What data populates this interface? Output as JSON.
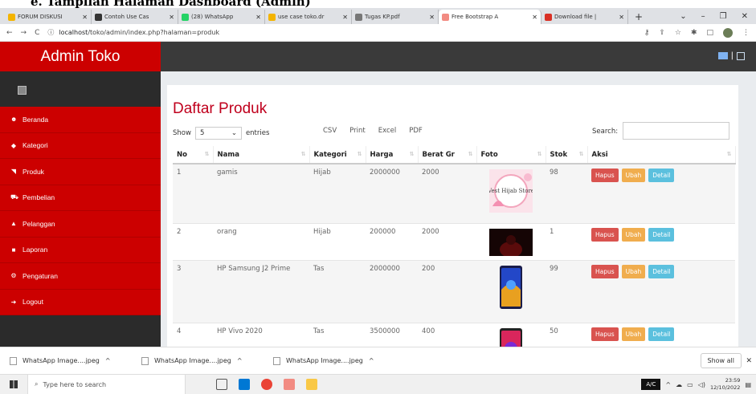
{
  "doc_caption": "e.  Tampilan Halaman Dashboard (Admin)",
  "browser": {
    "tabs": [
      {
        "label": "FORUM DISKUSI",
        "color": "#f4b400"
      },
      {
        "label": "Contoh Use Cas",
        "color": "#333333"
      },
      {
        "label": "(28) WhatsApp",
        "color": "#25d366"
      },
      {
        "label": "use case toko.dr",
        "color": "#f4b400"
      },
      {
        "label": "Tugas KP.pdf",
        "color": "#777777"
      },
      {
        "label": "Free Bootstrap A",
        "color": "#f28b82",
        "active": true
      },
      {
        "label": "Download file | ",
        "color": "#d93025"
      }
    ],
    "new_tab": "+",
    "url_host": "localhost",
    "url_path": "/toko/admin/index.php?halaman=produk"
  },
  "app": {
    "brand": "Admin Toko",
    "sidebar": [
      {
        "icon": "☻",
        "label": "Beranda",
        "name": "sidebar-item-beranda"
      },
      {
        "icon": "◆",
        "label": "Kategori",
        "name": "sidebar-item-kategori"
      },
      {
        "icon": "◥",
        "label": "Produk",
        "name": "sidebar-item-produk"
      },
      {
        "icon": "⛟",
        "label": "Pembelian",
        "name": "sidebar-item-pembelian"
      },
      {
        "icon": "▲",
        "label": "Pelanggan",
        "name": "sidebar-item-pelanggan"
      },
      {
        "icon": "■",
        "label": "Laporan",
        "name": "sidebar-item-laporan"
      },
      {
        "icon": "⚙",
        "label": "Pengaturan",
        "name": "sidebar-item-pengaturan"
      },
      {
        "icon": "➜",
        "label": "Logout",
        "name": "sidebar-item-logout"
      }
    ],
    "page_title": "Daftar Produk",
    "show_label": "Show",
    "show_value": "5",
    "entries_label": "entries",
    "export_buttons": [
      "CSV",
      "Print",
      "Excel",
      "PDF"
    ],
    "search_label": "Search:",
    "columns": [
      "No",
      "Nama",
      "Kategori",
      "Harga",
      "Berat Gr",
      "Foto",
      "Stok",
      "Aksi"
    ],
    "rows": [
      {
        "no": "1",
        "nama": "gamis",
        "kategori": "Hijab",
        "harga": "2000000",
        "berat": "2000",
        "stok": "98",
        "foto": "pink-store-image"
      },
      {
        "no": "2",
        "nama": "orang",
        "kategori": "Hijab",
        "harga": "200000",
        "berat": "2000",
        "stok": "1",
        "foto": "dark-red-image"
      },
      {
        "no": "3",
        "nama": "HP Samsung J2 Prime",
        "kategori": "Tas",
        "harga": "2000000",
        "berat": "200",
        "stok": "99",
        "foto": "phone-image"
      },
      {
        "no": "4",
        "nama": "HP Vivo 2020",
        "kategori": "Tas",
        "harga": "3500000",
        "berat": "400",
        "stok": "50",
        "foto": "phone-image-2"
      }
    ],
    "actions": {
      "delete": "Hapus",
      "edit": "Ubah",
      "detail": "Detail"
    },
    "photo_caption": "Vest Hijab Store"
  },
  "downloads": {
    "items": [
      "WhatsApp Image....jpeg",
      "WhatsApp Image....jpeg",
      "WhatsApp Image....jpeg"
    ],
    "show_all": "Show all"
  },
  "taskbar": {
    "search_placeholder": "Type here to search",
    "ac": "A/C",
    "time": "23:59",
    "date": "12/10/2022"
  }
}
